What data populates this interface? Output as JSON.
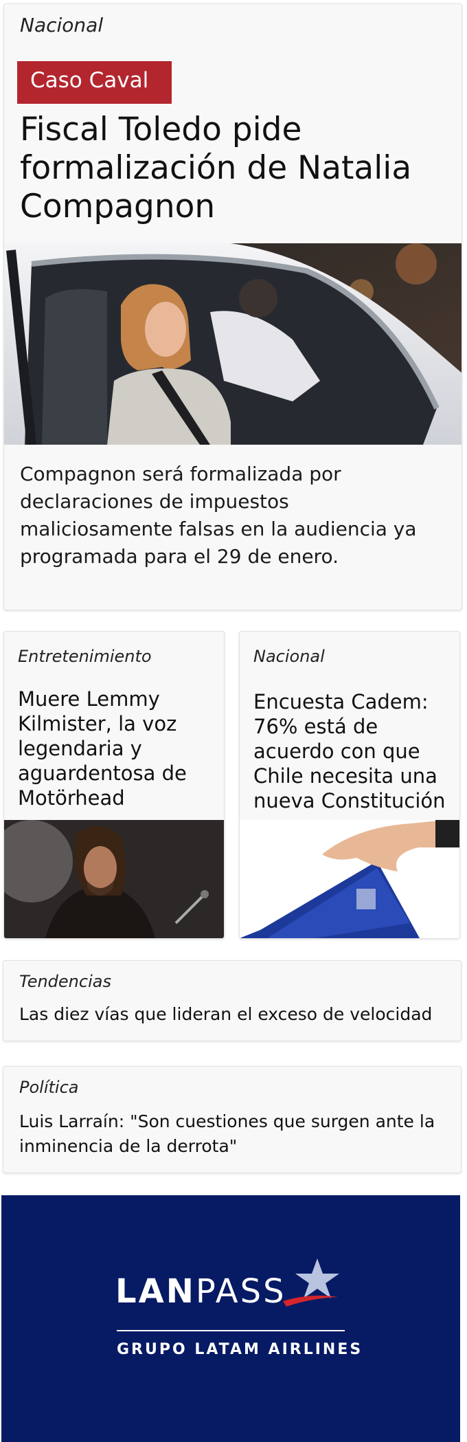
{
  "featured": {
    "section": "Nacional",
    "tag": "Caso Caval",
    "headline": "Fiscal Toledo pide formalización de Natalia Compagnon",
    "summary": "Compagnon será formalizada por declaraciones de impuestos maliciosamente falsas en la audiencia ya programada para el 29 de enero."
  },
  "cards": [
    {
      "section": "Entretenimiento",
      "headline": "Muere Lemmy Kilmister, la voz legendaria y aguardentosa de Motörhead"
    },
    {
      "section": "Nacional",
      "headline": "Encuesta Cadem: 76% está de acuerdo con que Chile necesita una nueva Constitución"
    }
  ],
  "text_cards": [
    {
      "section": "Tendencias",
      "headline": "Las diez vías que lideran el exceso de velocidad"
    },
    {
      "section": "Política",
      "headline": "Luis Larraín: \"Son cuestiones que surgen ante la inminencia de la derrota\""
    }
  ],
  "ad": {
    "brand_lan": "LAN",
    "brand_pass": "PASS",
    "tagline": "GRUPO LATAM AIRLINES",
    "background": "#071a64"
  },
  "colors": {
    "tag": "#b3262e",
    "card_bg": "#f8f8f8"
  }
}
